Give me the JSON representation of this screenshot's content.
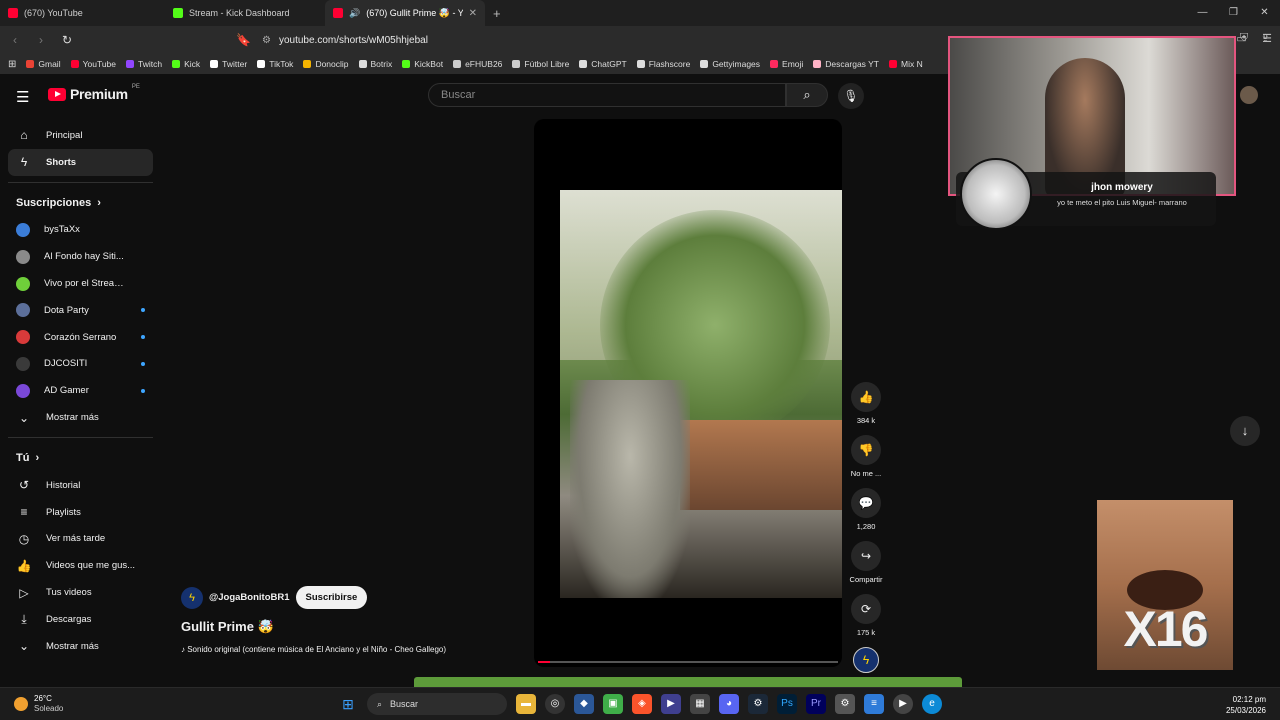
{
  "browser": {
    "tabs": [
      {
        "title": "(670) YouTube",
        "color": "#ff0033"
      },
      {
        "title": "Stream - Kick Dashboard",
        "color": "#53fc18"
      },
      {
        "title": "(670) Gullit Prime 🤯 - YouTu",
        "color": "#ff0033"
      }
    ],
    "new_tab": "+",
    "url": "youtube.com/shorts/wM05hhjebal",
    "bookmarks": [
      {
        "label": "Gmail",
        "color": "#ea4335"
      },
      {
        "label": "YouTube",
        "color": "#ff0033"
      },
      {
        "label": "Twitch",
        "color": "#9146ff"
      },
      {
        "label": "Kick",
        "color": "#53fc18"
      },
      {
        "label": "Twitter",
        "color": "#ffffff"
      },
      {
        "label": "TikTok",
        "color": "#ffffff"
      },
      {
        "label": "Donoclip",
        "color": "#f5b400"
      },
      {
        "label": "Botrix",
        "color": "#dddddd"
      },
      {
        "label": "KickBot",
        "color": "#53fc18"
      },
      {
        "label": "eFHUB26",
        "color": "#cccccc"
      },
      {
        "label": "Fútbol Libre",
        "color": "#cccccc"
      },
      {
        "label": "ChatGPT",
        "color": "#dddddd"
      },
      {
        "label": "Flashscore",
        "color": "#dddddd"
      },
      {
        "label": "Gettyimages",
        "color": "#dddddd"
      },
      {
        "label": "Emoji",
        "color": "#ff2a5f"
      },
      {
        "label": "Descargas YT",
        "color": "#ffb3c6"
      },
      {
        "label": "Mix N",
        "color": "#ff0033"
      }
    ]
  },
  "youtube": {
    "logo_text": "Premium",
    "logo_region": "PE",
    "search_placeholder": "Buscar",
    "sidebar": {
      "main": [
        {
          "label": "Principal",
          "icon": "home-icon"
        },
        {
          "label": "Shorts",
          "icon": "shorts-icon",
          "active": true
        }
      ],
      "subs_header": "Suscripciones",
      "subscriptions": [
        {
          "label": "bysTaXx",
          "color": "#3b7dd8",
          "dot": false
        },
        {
          "label": "Al Fondo hay Siti...",
          "color": "#8a8a8a",
          "dot": false
        },
        {
          "label": "Vivo por el Streami...",
          "color": "#6fcf3a",
          "dot": false
        },
        {
          "label": "Dota Party",
          "color": "#5c6f9a",
          "dot": true
        },
        {
          "label": "Corazón Serrano",
          "color": "#d83a3a",
          "dot": true
        },
        {
          "label": "DJCOSITI",
          "color": "#3a3a3a",
          "dot": true
        },
        {
          "label": "AD Gamer",
          "color": "#7a48d8",
          "dot": true
        }
      ],
      "show_more_1": "Mostrar más",
      "you_header": "Tú",
      "you_items": [
        {
          "label": "Historial",
          "icon": "history-icon"
        },
        {
          "label": "Playlists",
          "icon": "playlist-icon"
        },
        {
          "label": "Ver más tarde",
          "icon": "clock-icon"
        },
        {
          "label": "Videos que me gus...",
          "icon": "like-icon"
        },
        {
          "label": "Tus videos",
          "icon": "video-icon"
        },
        {
          "label": "Descargas",
          "icon": "download-icon"
        }
      ],
      "show_more_2": "Mostrar más"
    },
    "short": {
      "channel": "@JogaBonitoBR1",
      "subscribe": "Suscribirse",
      "title": "Gullit Prime 🤯",
      "music": "♪ Sonido original (contiene música de El Anciano y el Niño - Cheo Gallego)",
      "progress_fraction": 0.04,
      "actions": [
        {
          "label": "384 k",
          "icon": "thumbs-up-icon",
          "glyph": "👍"
        },
        {
          "label": "No me ...",
          "icon": "thumbs-down-icon",
          "glyph": "👎"
        },
        {
          "label": "1,280",
          "icon": "comment-icon",
          "glyph": "💬"
        },
        {
          "label": "Compartir",
          "icon": "share-icon",
          "glyph": "↪"
        },
        {
          "label": "175 k",
          "icon": "remix-icon",
          "glyph": "⟳"
        }
      ]
    }
  },
  "overlay": {
    "chat_user": "jhon mowery",
    "chat_message": "yo te meto el pito Luis Miguel- marrano",
    "meme_text": "X16"
  },
  "taskbar": {
    "temperature": "26°C",
    "weather": "Soleado",
    "search": "Buscar",
    "time": "02:12 pm",
    "date": "25/03/2026"
  }
}
